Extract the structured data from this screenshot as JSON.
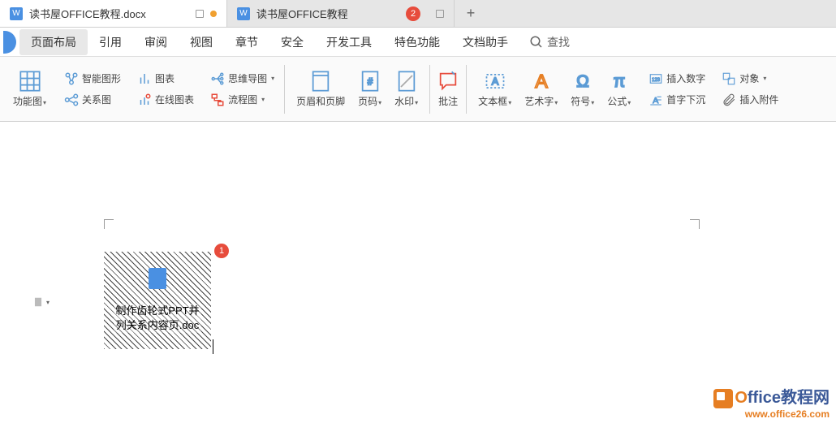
{
  "tabs": [
    {
      "title": "读书屋OFFICE教程.docx",
      "modified": true
    },
    {
      "title": "读书屋OFFICE教程",
      "modified": false
    }
  ],
  "badges": {
    "b1": "1",
    "b2": "2"
  },
  "menu": {
    "items": [
      "页面布局",
      "引用",
      "审阅",
      "视图",
      "章节",
      "安全",
      "开发工具",
      "特色功能",
      "文档助手"
    ],
    "search": "查找"
  },
  "ribbon": {
    "col1a": "功能图",
    "smart": "智能图形",
    "chart": "图表",
    "rel": "关系图",
    "online": "在线图表",
    "mind": "思维导图",
    "flow": "流程图",
    "header": "页眉和页脚",
    "pagenum": "页码",
    "watermark": "水印",
    "comment": "批注",
    "textbox": "文本框",
    "wordart": "艺术字",
    "symbol": "符号",
    "formula": "公式",
    "insertnum": "插入数字",
    "object": "对象",
    "dropcap": "首字下沉",
    "attach": "插入附件"
  },
  "embedded": {
    "line1": "制作齿轮式PPT并",
    "line2": "列关系内容页.doc"
  },
  "watermark": {
    "brand_o": "O",
    "brand_rest": "ffice教程网",
    "url": "www.office26.com"
  }
}
